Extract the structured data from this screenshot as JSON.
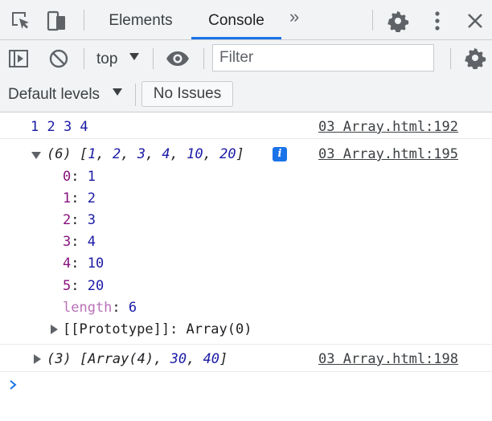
{
  "tabs": {
    "items": [
      {
        "label": "Elements",
        "active": false
      },
      {
        "label": "Console",
        "active": true
      }
    ],
    "more_label": "»"
  },
  "icons": {
    "inspect": "inspect-element-icon",
    "device": "device-toolbar-icon",
    "settings": "gear-icon",
    "kebab": "more-options-icon",
    "close": "close-icon",
    "sidebar": "show-console-sidebar-icon",
    "clear": "clear-console-icon",
    "eye": "live-expression-eye-icon"
  },
  "toolbar": {
    "context": "top",
    "filter_placeholder": "Filter",
    "levels": "Default levels",
    "issues": "No Issues"
  },
  "colors": {
    "accent": "#1a73e8",
    "number": "#1a1aa6",
    "property_key": "#881280",
    "panel_bg": "#f1f3f4"
  },
  "console": {
    "messages": [
      {
        "text": "1 2 3 4",
        "source": "03 Array.html:192"
      },
      {
        "summary": {
          "count": "(6)",
          "open": "[",
          "values": [
            "1",
            "2",
            "3",
            "4",
            "10",
            "20"
          ],
          "close": "]"
        },
        "info_badge": "i",
        "source": "03 Array.html:195",
        "expanded": true,
        "entries": [
          {
            "key": "0",
            "value": "1"
          },
          {
            "key": "1",
            "value": "2"
          },
          {
            "key": "2",
            "value": "3"
          },
          {
            "key": "3",
            "value": "4"
          },
          {
            "key": "4",
            "value": "10"
          },
          {
            "key": "5",
            "value": "20"
          }
        ],
        "length": {
          "key": "length",
          "value": "6"
        },
        "prototype": {
          "key": "[[Prototype]]",
          "value": "Array(0)"
        }
      },
      {
        "summary": {
          "count": "(3)",
          "open": "[",
          "values": [
            "Array(4)",
            "30",
            "40"
          ],
          "close": "]"
        },
        "source": "03 Array.html:198",
        "expanded": false
      }
    ],
    "prompt": "›"
  }
}
